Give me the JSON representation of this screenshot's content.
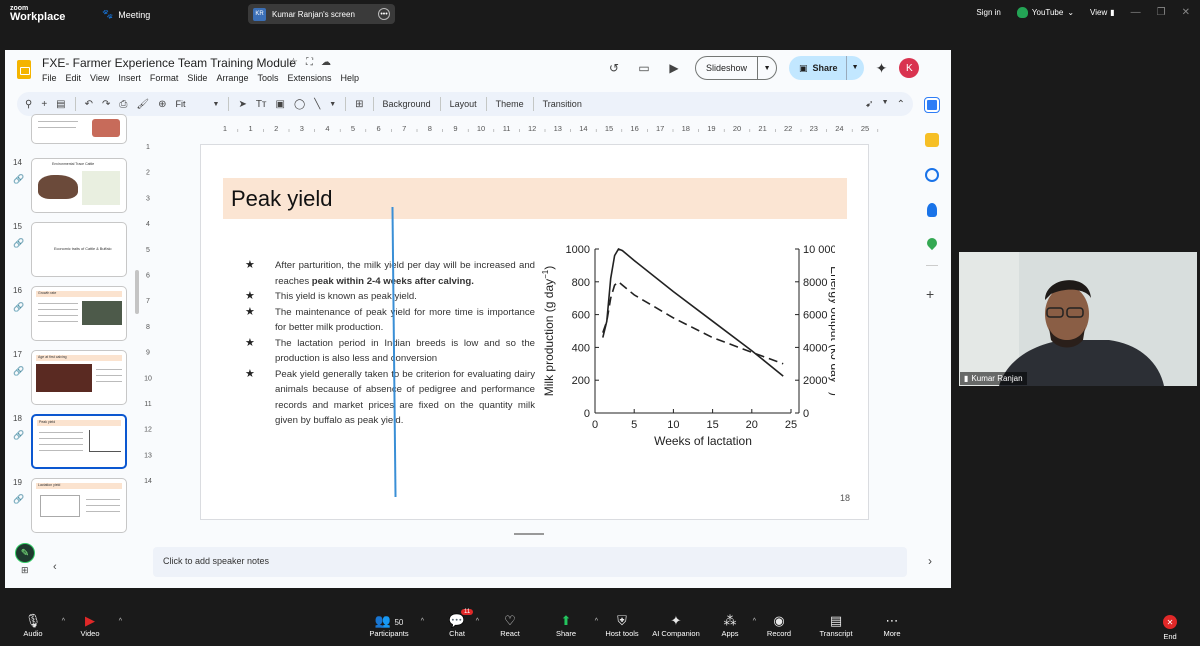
{
  "zoom": {
    "logo_top": "zoom",
    "logo_bottom": "Workplace",
    "meeting_label": "Meeting",
    "screen_initials": "KR",
    "screen_label": "Kumar Ranjan's screen",
    "signin": "Sign in",
    "youtube": "YouTube",
    "view": "View"
  },
  "doc": {
    "title": "FXE- Farmer Experience Team Training Module",
    "menus": [
      "File",
      "Edit",
      "View",
      "Insert",
      "Format",
      "Slide",
      "Arrange",
      "Tools",
      "Extensions",
      "Help"
    ],
    "slideshow": "Slideshow",
    "share": "Share",
    "avatar": "K"
  },
  "toolbar": {
    "zoom": "Fit",
    "background": "Background",
    "layout": "Layout",
    "theme": "Theme",
    "transition": "Transition"
  },
  "filmstrip": {
    "items": [
      {
        "num": "14",
        "caption": "Environmental Trace Cattle"
      },
      {
        "num": "15",
        "caption": "Economic traits of Cattle & Buffalo"
      },
      {
        "num": "16",
        "caption": "Growth rate"
      },
      {
        "num": "17",
        "caption": "Age at first calving"
      },
      {
        "num": "18",
        "caption": "Peak yield"
      },
      {
        "num": "19",
        "caption": "Lactation yield"
      }
    ]
  },
  "ruler": {
    "h_ticks": [
      "1",
      "1",
      "2",
      "3",
      "4",
      "5",
      "6",
      "7",
      "8",
      "9",
      "10",
      "11",
      "12",
      "13",
      "14",
      "15",
      "16",
      "17",
      "18",
      "19",
      "20",
      "21",
      "22",
      "23",
      "24",
      "25"
    ],
    "v_ticks": [
      "1",
      "2",
      "3",
      "4",
      "5",
      "6",
      "7",
      "8",
      "9",
      "10",
      "11",
      "12",
      "13",
      "14"
    ]
  },
  "slide": {
    "title": "Peak yield",
    "bullets": [
      {
        "pre": "After parturition, the milk yield per day will be increased and reaches ",
        "bold": "peak within 2-4 weeks after calving.",
        "post": ""
      },
      {
        "pre": "This yield is known as peak yield.",
        "bold": "",
        "post": ""
      },
      {
        "pre": "The maintenance of peak yield for more time is importance for better milk production.",
        "bold": "",
        "post": ""
      },
      {
        "pre": "The lactation period in Indian breeds is low and so the production is also less and conversion",
        "bold": "",
        "post": ""
      },
      {
        "pre": "Peak yield generally taken to be criterion for evaluating dairy animals because of absence of pedigree and performance records and market prices are fixed on the quantity milk given by buffalo as peak yield.",
        "bold": "",
        "post": ""
      }
    ],
    "star": "★",
    "number": "18"
  },
  "chart_data": {
    "type": "line",
    "xlabel": "Weeks of lactation",
    "ylabel": "Milk production (g day",
    "ylabel_sup": "−1",
    "ylabel_end": ")",
    "y2label": "Energy output (kJ day",
    "y2label_sup": "−1",
    "y2label_end": ")",
    "xlim": [
      0,
      25
    ],
    "ylim": [
      0,
      1000
    ],
    "y2lim": [
      0,
      10000
    ],
    "xticks": [
      "0",
      "5",
      "10",
      "15",
      "20",
      "25"
    ],
    "xtick_values": [
      0,
      5,
      10,
      15,
      20,
      25
    ],
    "yticks": [
      "0",
      "200",
      "400",
      "600",
      "800",
      "1000"
    ],
    "ytick_values": [
      0,
      200,
      400,
      600,
      800,
      1000
    ],
    "y2ticks": [
      "0",
      "2000",
      "4000",
      "6000",
      "8000",
      "10 000"
    ],
    "y2tick_values": [
      0,
      2000,
      4000,
      6000,
      8000,
      10000
    ],
    "series": [
      {
        "style": "solid",
        "x": [
          1,
          1.5,
          2,
          2.5,
          3,
          3.5,
          5,
          10,
          15,
          20,
          24
        ],
        "y": [
          460,
          560,
          820,
          960,
          1000,
          990,
          930,
          740,
          560,
          380,
          225
        ]
      },
      {
        "style": "dashed",
        "x": [
          1,
          1.5,
          2,
          2.5,
          3,
          3.5,
          5,
          10,
          15,
          20,
          24
        ],
        "y": [
          490,
          560,
          700,
          780,
          800,
          780,
          720,
          580,
          460,
          370,
          300
        ]
      }
    ]
  },
  "notes": {
    "placeholder": "Click to add speaker notes"
  },
  "selfview": {
    "name": "Kumar Ranjan"
  },
  "bottombar": {
    "audio": "Audio",
    "video": "Video",
    "participants": "Participants",
    "participants_count": "50",
    "chat": "Chat",
    "chat_badge": "11",
    "react": "React",
    "share": "Share",
    "host_tools": "Host tools",
    "ai_companion": "AI Companion",
    "apps": "Apps",
    "record": "Record",
    "transcript": "Transcript",
    "more": "More",
    "end": "End"
  },
  "colors": {
    "zoom_bg": "#1a1a1a",
    "title_band": "#fbe5d3",
    "share_btn": "#c2e7ff",
    "selected_thumb": "#0b57d0",
    "end_red": "#e02828"
  }
}
